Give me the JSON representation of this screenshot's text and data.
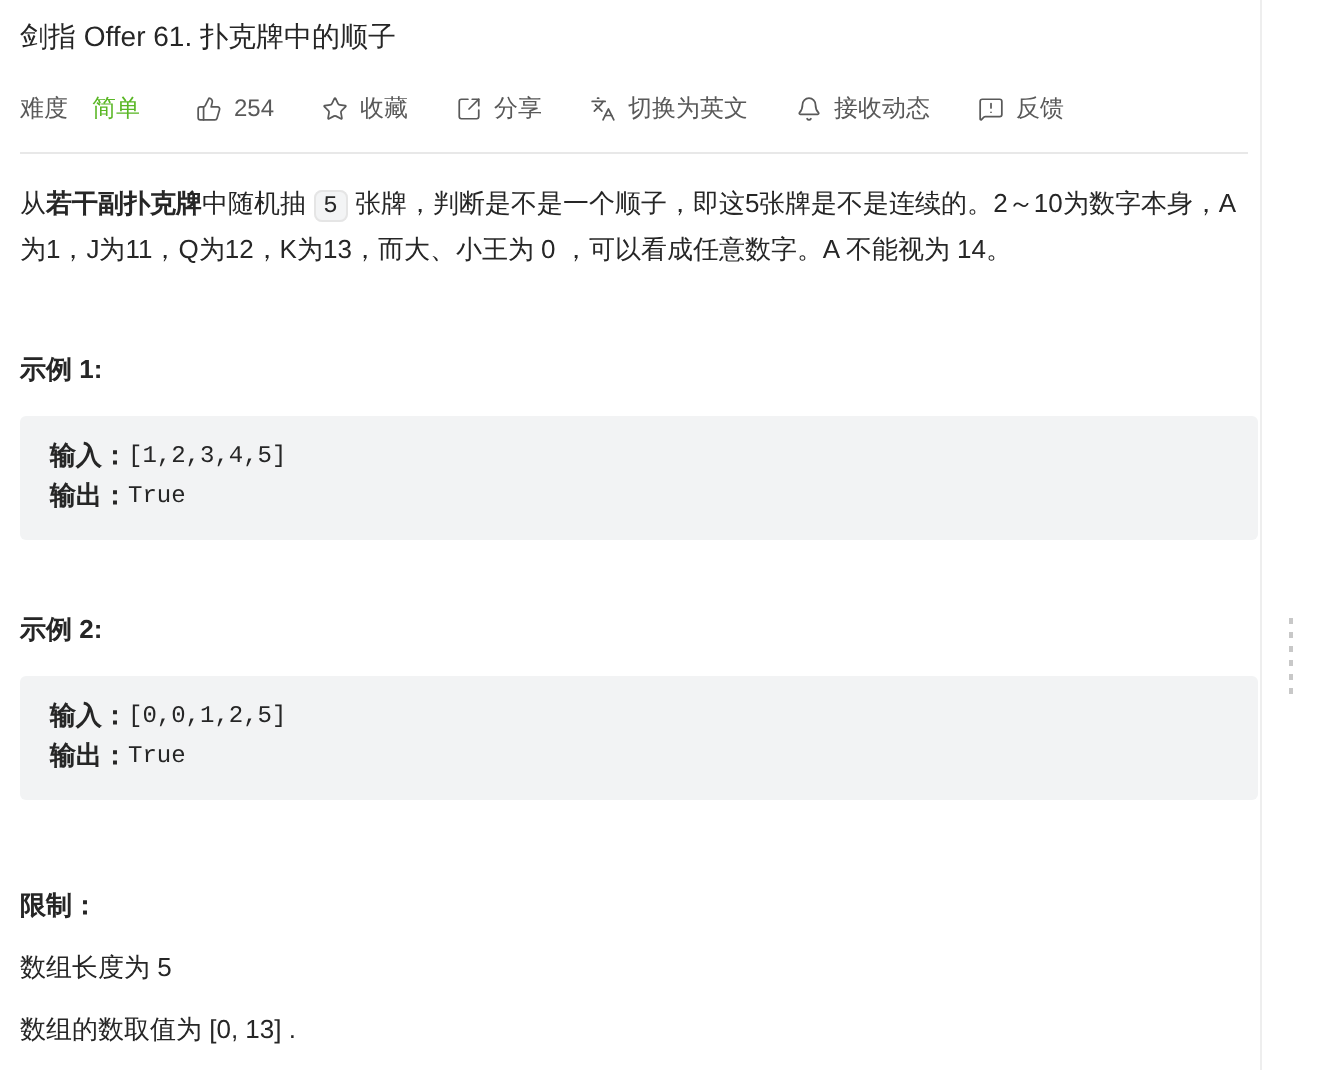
{
  "title": "剑指 Offer 61. 扑克牌中的顺子",
  "toolbar": {
    "difficulty_label": "难度",
    "difficulty": "简单",
    "actions": [
      {
        "kind": "like",
        "label": "254"
      },
      {
        "kind": "star",
        "label": "收藏"
      },
      {
        "kind": "share",
        "label": "分享"
      },
      {
        "kind": "translate",
        "label": "切换为英文"
      },
      {
        "kind": "bell",
        "label": "接收动态"
      },
      {
        "kind": "feedback",
        "label": "反馈"
      }
    ]
  },
  "description": [
    {
      "kind": "text",
      "text": "从**若干副扑克牌**中随机抽 "
    },
    {
      "kind": "code",
      "text": "5"
    },
    {
      "kind": "text",
      "text": " 张牌，判断是不是一个顺子，即这5张牌是不是连续的。2～10为数字本身，A为1，J为11，Q为12，K为13，而大、小王为 0 ，可以看成任意数字。A 不能视为 14。"
    }
  ],
  "examples": [
    {
      "title": "示例 1:",
      "lines": [
        {
          "label": "输入：",
          "value": "[1,2,3,4,5]"
        },
        {
          "label": "输出：",
          "value": "True"
        }
      ]
    },
    {
      "title": "示例 2:",
      "lines": [
        {
          "label": "输入：",
          "value": "[0,0,1,2,5]"
        },
        {
          "label": "输出：",
          "value": "True"
        }
      ]
    }
  ],
  "limits": {
    "title": "限制：",
    "items": [
      "数组长度为 5",
      "数组的数取值为 [0, 13] ."
    ]
  }
}
